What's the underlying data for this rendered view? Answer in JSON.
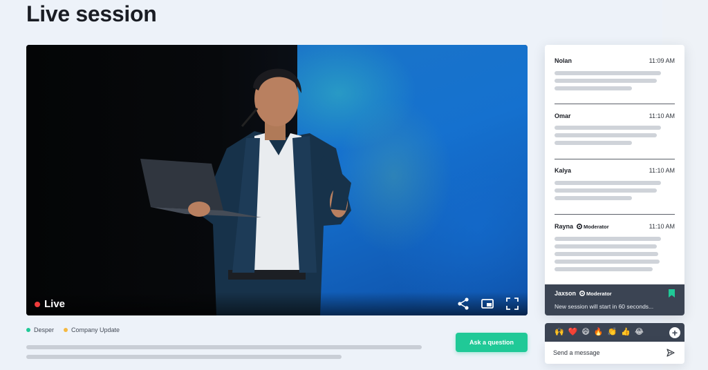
{
  "page": {
    "title": "Live session"
  },
  "video": {
    "live_label": "Live",
    "controls": {
      "share_icon": "share-icon",
      "pip_icon": "picture-in-picture-icon",
      "fullscreen_icon": "fullscreen-icon"
    }
  },
  "tags": [
    {
      "label": "Desper",
      "color": "#20c997"
    },
    {
      "label": "Company Update",
      "color": "#f5b942"
    }
  ],
  "ask_button": {
    "label": "Ask a question"
  },
  "chat": {
    "messages": [
      {
        "name": "Nolan",
        "time": "11:09 AM",
        "moderator": false
      },
      {
        "name": "Omar",
        "time": "11:10 AM",
        "moderator": false
      },
      {
        "name": "Kalya",
        "time": "11:10 AM",
        "moderator": false
      },
      {
        "name": "Rayna",
        "time": "11:10 AM",
        "moderator": true,
        "badge": "Moderator"
      }
    ],
    "pinned": {
      "name": "Jaxson",
      "badge": "Moderator",
      "text": "New session will start in 60 seconds..."
    }
  },
  "reactions": [
    "🙌",
    "❤️",
    "😄",
    "🔥",
    "👏",
    "👍",
    "😂"
  ],
  "composer": {
    "placeholder": "Send a message"
  },
  "colors": {
    "accent": "#20c997",
    "live": "#ef3b3b",
    "chat_dark": "#3b4453"
  }
}
